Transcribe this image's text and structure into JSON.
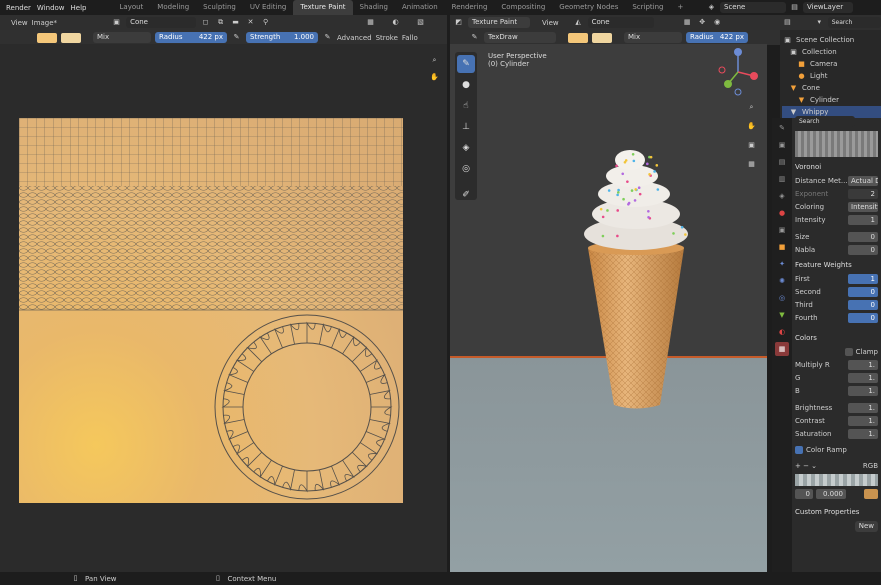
{
  "menu": [
    "Render",
    "Window",
    "Help"
  ],
  "workspaces": [
    "Layout",
    "Modeling",
    "Sculpting",
    "UV Editing",
    "Texture Paint",
    "Shading",
    "Animation",
    "Rendering",
    "Compositing",
    "Geometry Nodes",
    "Scripting",
    "+"
  ],
  "active_ws": "Texture Paint",
  "scene": "Scene",
  "view_layer": "ViewLayer",
  "img_editor": {
    "view": "View",
    "image": "Image*",
    "object": "Cone",
    "mix": "Mix",
    "radius_label": "Radius",
    "radius": "422 px",
    "strength_label": "Strength",
    "strength": "1.000",
    "advanced": "Advanced",
    "stroke": "Stroke",
    "falloff": "Fallo"
  },
  "viewport": {
    "mode": "Texture Paint",
    "view": "View",
    "object": "Cone",
    "brush": "TexDraw",
    "mix": "Mix",
    "radius_label": "Radius",
    "radius": "422 px",
    "persp": "User Perspective",
    "object_info": "(0) Cylinder"
  },
  "outliner": {
    "search": "Search",
    "items": [
      "Scene Collection",
      "Collection",
      "Camera",
      "Light",
      "Cone",
      "Cylinder",
      "Whippy"
    ]
  },
  "props": {
    "search": "Search",
    "voronoi": "Voronoi",
    "distance_label": "Distance Met...",
    "distance": "Actual Di",
    "exponent": "Exponent",
    "exponent_v": "2",
    "coloring": "Coloring",
    "coloring_v": "Intensity",
    "intensity": "Intensity",
    "intensity_v": "1",
    "size": "Size",
    "size_v": "0",
    "noise": "Nabla",
    "noise_v": "0",
    "fw": "Feature Weights",
    "first": "First",
    "second": "Second",
    "third": "Third",
    "fourth": "Fourth",
    "fw_v": [
      "1",
      "0",
      "0",
      "0"
    ],
    "colors": "Colors",
    "clamp": "Clamp",
    "mulr": "Multiply R",
    "g": "G",
    "b": "B",
    "c_v": [
      "1.",
      "1.",
      "1."
    ],
    "brightness": "Brightness",
    "contrast": "Contrast",
    "saturation": "Saturation",
    "bcs_v": [
      "1.",
      "1.",
      "1."
    ],
    "ramp": "Color Ramp",
    "rgb": "RGB",
    "ramp_idx": "0",
    "ramp_pos": "0.000",
    "custom": "Custom Properties",
    "new": "New"
  },
  "status": {
    "pan": "Pan View",
    "ctx": "Context Menu"
  }
}
